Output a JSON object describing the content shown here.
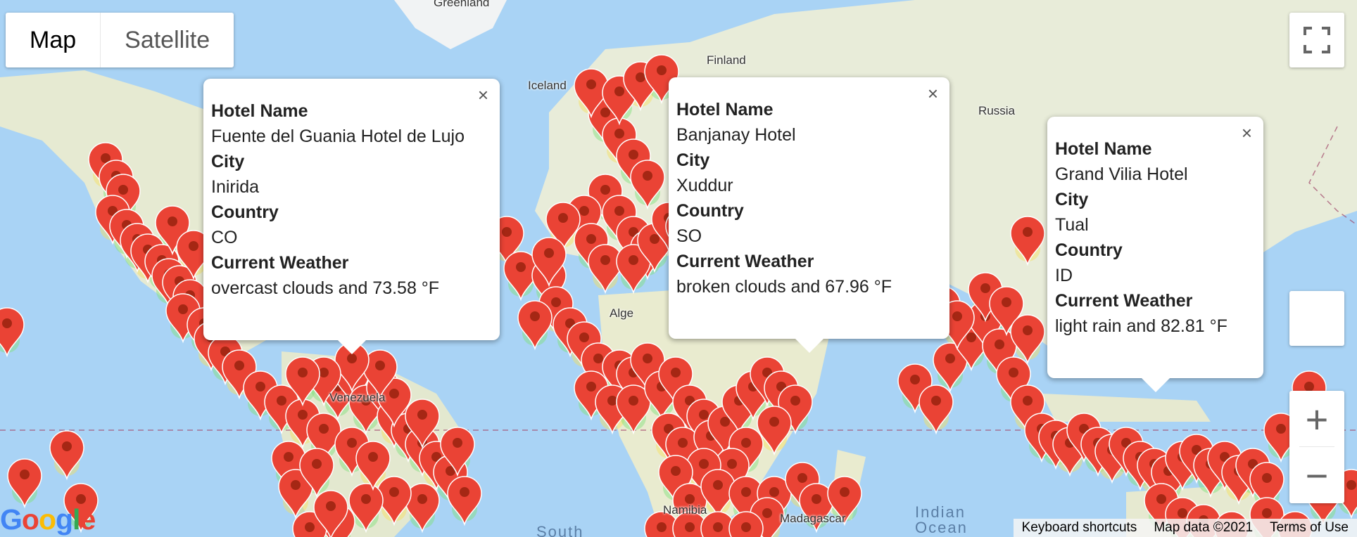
{
  "map_type": {
    "map_label": "Map",
    "satellite_label": "Satellite",
    "selected": "Map"
  },
  "places": {
    "greenland": "Greenland",
    "finland": "Finland",
    "iceland": "Iceland",
    "russia": "Russia",
    "venezuela": "Venezuela",
    "algeria": "Alge",
    "namibia": "Namibia",
    "madagascar": "Madagascar",
    "indian_ocean_1": "Indian",
    "indian_ocean_2": "Ocean",
    "south": "South"
  },
  "info_windows": [
    {
      "hotel_label": "Hotel Name",
      "hotel": "Fuente del Guania Hotel de Lujo",
      "city_label": "City",
      "city": "Inirida",
      "country_label": "Country",
      "country": "CO",
      "weather_label": "Current Weather",
      "weather": "overcast clouds and 73.58 °F"
    },
    {
      "hotel_label": "Hotel Name",
      "hotel": "Banjanay Hotel",
      "city_label": "City",
      "city": "Xuddur",
      "country_label": "Country",
      "country": "SO",
      "weather_label": "Current Weather",
      "weather": "broken clouds and 67.96 °F"
    },
    {
      "hotel_label": "Hotel Name",
      "hotel": "Grand Vilia Hotel",
      "city_label": "City",
      "city": "Tual",
      "country_label": "Country",
      "country": "ID",
      "weather_label": "Current Weather",
      "weather": "light rain and 82.81 °F"
    }
  ],
  "close_glyph": "×",
  "zoom": {
    "in": "+",
    "out": "−"
  },
  "footer": {
    "keyboard": "Keyboard shortcuts",
    "map_data": "Map data ©2021",
    "terms": "Terms of Use"
  },
  "logo": "Google",
  "colors": {
    "marker": "#ea4335",
    "marker_dot": "#a52714",
    "water": "#a9d3f5",
    "land": "#e8ecd9"
  }
}
